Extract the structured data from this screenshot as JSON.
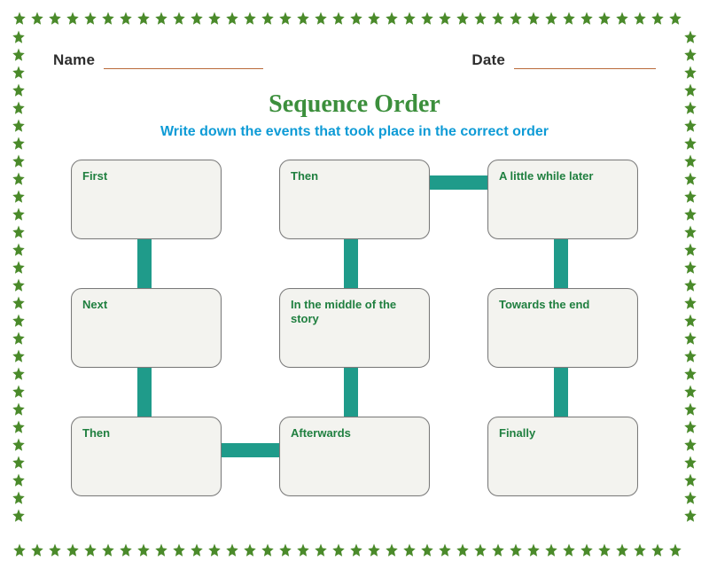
{
  "colors": {
    "star": "#4a8a2a",
    "title": "#3c8f3c",
    "subtitle": "#0e9bd6",
    "box_text": "#1f7f3f",
    "connector": "#1f9b8a",
    "line": "#b96a3a"
  },
  "header": {
    "name_label": "Name",
    "name_value": "",
    "date_label": "Date",
    "date_value": ""
  },
  "title": "Sequence Order",
  "subtitle": "Write down the events that took place in the correct order",
  "boxes": {
    "first": "First",
    "then1": "Then",
    "little_while": "A little while later",
    "next": "Next",
    "middle": "In the middle of the story",
    "towards_end": "Towards the end",
    "then2": "Then",
    "afterwards": "Afterwards",
    "finally": "Finally"
  }
}
